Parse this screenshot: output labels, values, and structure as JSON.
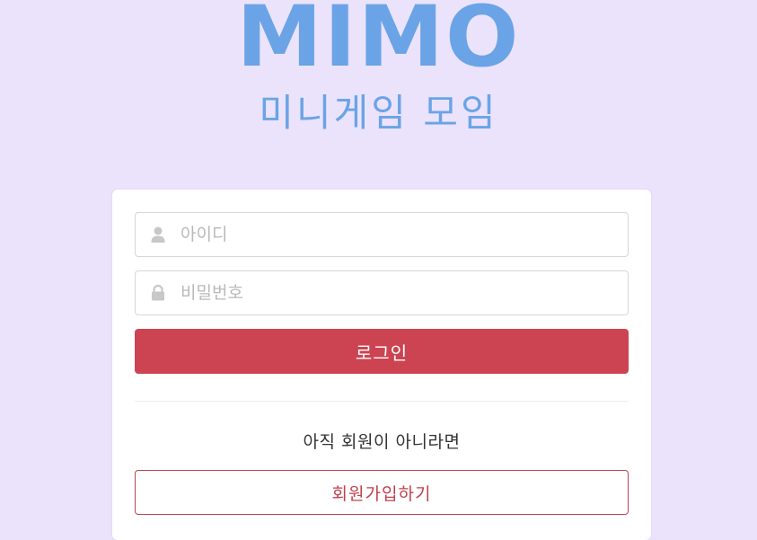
{
  "header": {
    "logo_text": "MIMO",
    "subtitle": "미니게임 모임"
  },
  "login_form": {
    "id_placeholder": "아이디",
    "id_value": "",
    "id_icon": "user-icon",
    "password_placeholder": "비밀번호",
    "password_value": "",
    "password_icon": "lock-icon",
    "login_label": "로그인",
    "signup_prompt": "아직 회원이 아니라면",
    "signup_label": "회원가입하기"
  },
  "colors": {
    "background": "#ebe2fc",
    "logo": "#6aa4e6",
    "subtitle": "#6aa4e6",
    "login_button": "#cc4452",
    "signup_text": "#c0404e",
    "signup_border": "#c0404e",
    "icon": "#c8c8c8"
  }
}
